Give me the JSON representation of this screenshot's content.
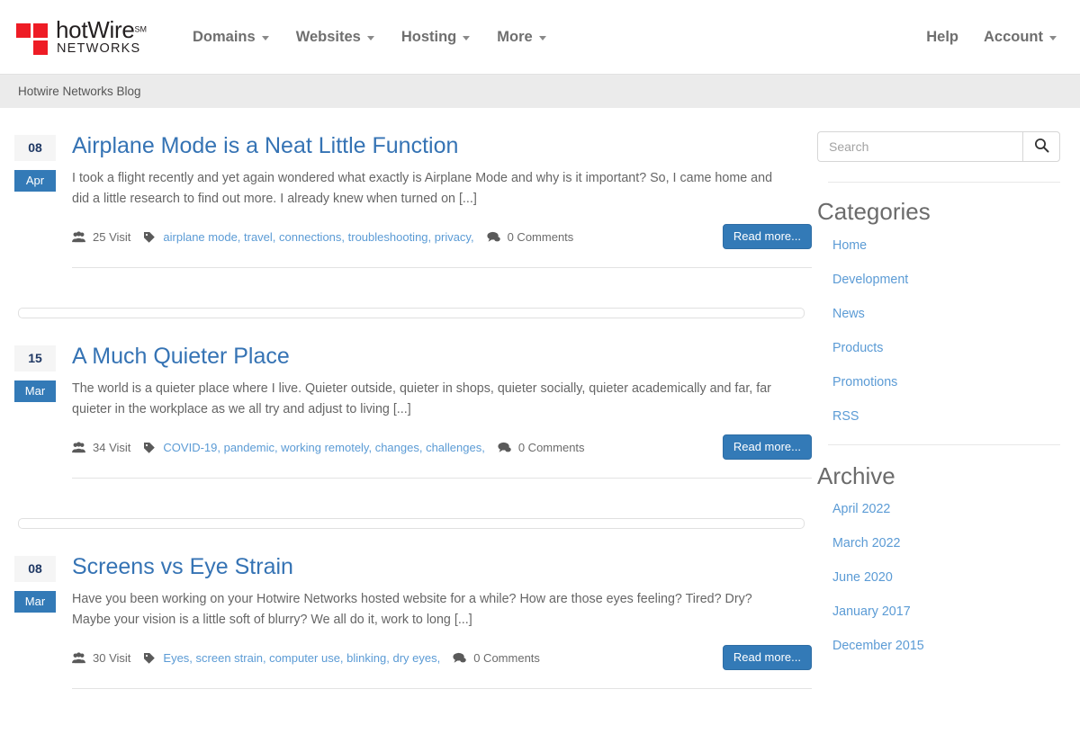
{
  "header": {
    "logo": {
      "main": "hotWire",
      "superscript": "SM",
      "sub": "NETWORKS"
    },
    "nav": [
      {
        "label": "Domains",
        "caret": true
      },
      {
        "label": "Websites",
        "caret": true
      },
      {
        "label": "Hosting",
        "caret": true
      },
      {
        "label": "More",
        "caret": true
      }
    ],
    "right_nav": [
      {
        "label": "Help",
        "caret": false
      },
      {
        "label": "Account",
        "caret": true
      }
    ]
  },
  "breadcrumb": {
    "text": "Hotwire Networks Blog"
  },
  "posts": [
    {
      "day": "08",
      "month": "Apr",
      "title": "Airplane Mode is a Neat Little Function",
      "excerpt": "I took a flight recently and yet again wondered what exactly is Airplane Mode and why is it important? So, I came home and did a little research to find out more. I already knew when turned on [...]",
      "visits": "25 Visit",
      "tags": "airplane mode, travel, connections, troubleshooting, privacy,",
      "comments": "0 Comments",
      "read_more": "Read more..."
    },
    {
      "day": "15",
      "month": "Mar",
      "title": "A Much Quieter Place",
      "excerpt": "The world is a quieter place where I live. Quieter outside, quieter in shops, quieter socially, quieter academically and far, far quieter in the workplace as we all try and adjust to living [...]",
      "visits": "34 Visit",
      "tags": "COVID-19, pandemic, working remotely, changes, challenges,",
      "comments": "0 Comments",
      "read_more": "Read more..."
    },
    {
      "day": "08",
      "month": "Mar",
      "title": "Screens vs Eye Strain",
      "excerpt": "Have you been working on your Hotwire Networks hosted website for a while?  How are those eyes feeling? Tired? Dry? Maybe your vision is a little soft of blurry? We all do it, work to long [...]",
      "visits": "30 Visit",
      "tags": "Eyes, screen strain, computer use, blinking, dry eyes,",
      "comments": "0 Comments",
      "read_more": "Read more..."
    }
  ],
  "sidebar": {
    "search": {
      "value": "",
      "placeholder": "Search"
    },
    "categories": {
      "heading": "Categories",
      "items": [
        {
          "label": "Home"
        },
        {
          "label": "Development"
        },
        {
          "label": "News"
        },
        {
          "label": "Products"
        },
        {
          "label": "Promotions"
        },
        {
          "label": "RSS"
        }
      ]
    },
    "archive": {
      "heading": "Archive",
      "items": [
        {
          "label": "April 2022"
        },
        {
          "label": "March 2022"
        },
        {
          "label": "June 2020"
        },
        {
          "label": "January 2017"
        },
        {
          "label": "December 2015"
        }
      ]
    }
  },
  "colors": {
    "brand_red": "#ee1c25",
    "link_blue": "#5b9bd5",
    "title_blue": "#3573b4",
    "button_blue": "#337ab7",
    "breadcrumb_bg": "#ebebeb"
  }
}
